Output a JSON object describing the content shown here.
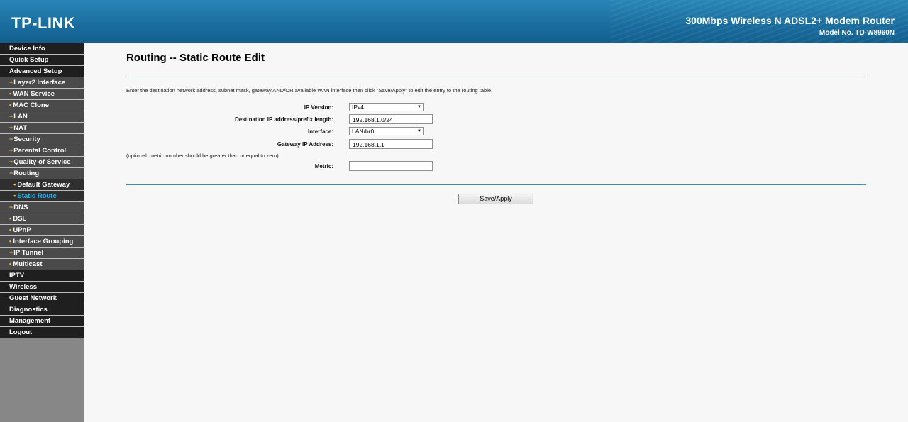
{
  "header": {
    "logo": "TP-LINK",
    "product_title": "300Mbps Wireless N ADSL2+ Modem Router",
    "model_no": "Model No. TD-W8960N"
  },
  "sidebar": {
    "items": [
      {
        "label": "Device Info",
        "level": "top",
        "marker": ""
      },
      {
        "label": "Quick Setup",
        "level": "top",
        "marker": ""
      },
      {
        "label": "Advanced Setup",
        "level": "top",
        "marker": ""
      },
      {
        "label": "Layer2 Interface",
        "level": "sub",
        "marker": "+"
      },
      {
        "label": "WAN Service",
        "level": "sub",
        "marker": "•"
      },
      {
        "label": "MAC Clone",
        "level": "sub",
        "marker": "•"
      },
      {
        "label": "LAN",
        "level": "sub",
        "marker": "+"
      },
      {
        "label": "NAT",
        "level": "sub",
        "marker": "+"
      },
      {
        "label": "Security",
        "level": "sub",
        "marker": "+"
      },
      {
        "label": "Parental Control",
        "level": "sub",
        "marker": "+"
      },
      {
        "label": "Quality of Service",
        "level": "sub",
        "marker": "+"
      },
      {
        "label": "Routing",
        "level": "sub",
        "marker": "−"
      },
      {
        "label": "Default Gateway",
        "level": "subsub",
        "marker": "•"
      },
      {
        "label": "Static Route",
        "level": "subsub",
        "marker": "•",
        "active": true
      },
      {
        "label": "DNS",
        "level": "sub",
        "marker": "+"
      },
      {
        "label": "DSL",
        "level": "sub",
        "marker": "•"
      },
      {
        "label": "UPnP",
        "level": "sub",
        "marker": "•"
      },
      {
        "label": "Interface Grouping",
        "level": "sub",
        "marker": "•"
      },
      {
        "label": "IP Tunnel",
        "level": "sub",
        "marker": "+"
      },
      {
        "label": "Multicast",
        "level": "sub",
        "marker": "•"
      },
      {
        "label": "IPTV",
        "level": "top",
        "marker": ""
      },
      {
        "label": "Wireless",
        "level": "top",
        "marker": ""
      },
      {
        "label": "Guest Network",
        "level": "top",
        "marker": ""
      },
      {
        "label": "Diagnostics",
        "level": "top",
        "marker": ""
      },
      {
        "label": "Management",
        "level": "top",
        "marker": ""
      },
      {
        "label": "Logout",
        "level": "top",
        "marker": ""
      }
    ]
  },
  "main": {
    "title": "Routing -- Static Route Edit",
    "description": "Enter the destination network address, subnet mask, gateway AND/OR available WAN interface then click \"Save/Apply\" to edit the entry to the routing table.",
    "form": {
      "ip_version_label": "IP Version:",
      "ip_version_value": "IPv4",
      "destination_label": "Destination IP address/prefix length:",
      "destination_value": "192.168.1.0/24",
      "interface_label": "Interface:",
      "interface_value": "LAN/br0",
      "gateway_label": "Gateway IP Address:",
      "gateway_value": "192.168.1.1",
      "optional_note": "(optional: metric number should be greater than or equal to zero)",
      "metric_label": "Metric:",
      "metric_value": ""
    },
    "save_label": "Save/Apply"
  },
  "colors": {
    "header_blue": "#1a6fa0",
    "active_menu": "#27b4e8",
    "menu_marker": "#f0c040"
  }
}
